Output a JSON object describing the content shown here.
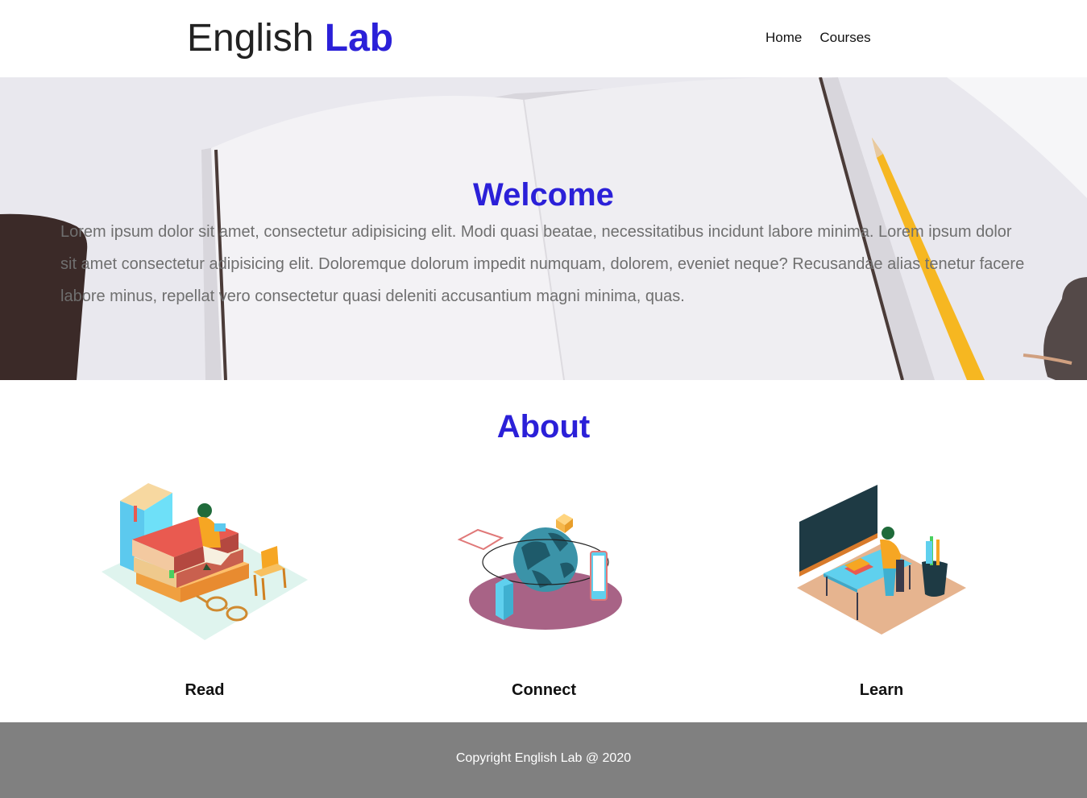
{
  "header": {
    "logo_text": "English",
    "logo_accent": "Lab",
    "nav": [
      {
        "label": "Home"
      },
      {
        "label": "Courses"
      }
    ]
  },
  "hero": {
    "title": "Welcome",
    "text": "Lorem ipsum dolor sit amet, consectetur adipisicing elit. Modi quasi beatae, necessitatibus incidunt labore minima. Lorem ipsum dolor sit amet consectetur adipisicing elit. Doloremque dolorum impedit numquam, dolorem, eveniet neque? Recusandae alias tenetur facere labore minus, repellat vero consectetur quasi deleniti accusantium magni minima, quas."
  },
  "about": {
    "title": "About",
    "features": [
      {
        "label": "Read",
        "icon": "books-reading-illustration"
      },
      {
        "label": "Connect",
        "icon": "globe-devices-illustration"
      },
      {
        "label": "Learn",
        "icon": "classroom-desk-illustration"
      }
    ]
  },
  "footer": {
    "copyright": "Copyright English Lab @ 2020"
  },
  "colors": {
    "accent": "#2b20d8",
    "footer_bg": "#808080"
  }
}
